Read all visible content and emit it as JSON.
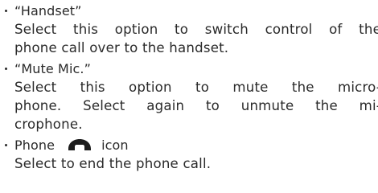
{
  "items": [
    {
      "term": "“Handset”",
      "desc_lines": [
        "Select this option to switch control of the",
        "phone call over to the handset."
      ]
    },
    {
      "term": "“Mute Mic.”",
      "desc_lines": [
        "Select this option to mute the micro-",
        "phone. Select again to unmute the mi-",
        "crophone."
      ]
    },
    {
      "term_before_icon": "Phone",
      "icon": "phone-handset-icon",
      "term_after_icon": "icon",
      "desc_lines": [
        "Select to end the phone call."
      ]
    }
  ],
  "colors": {
    "text": "#2a2a2a",
    "background": "#ffffff"
  }
}
